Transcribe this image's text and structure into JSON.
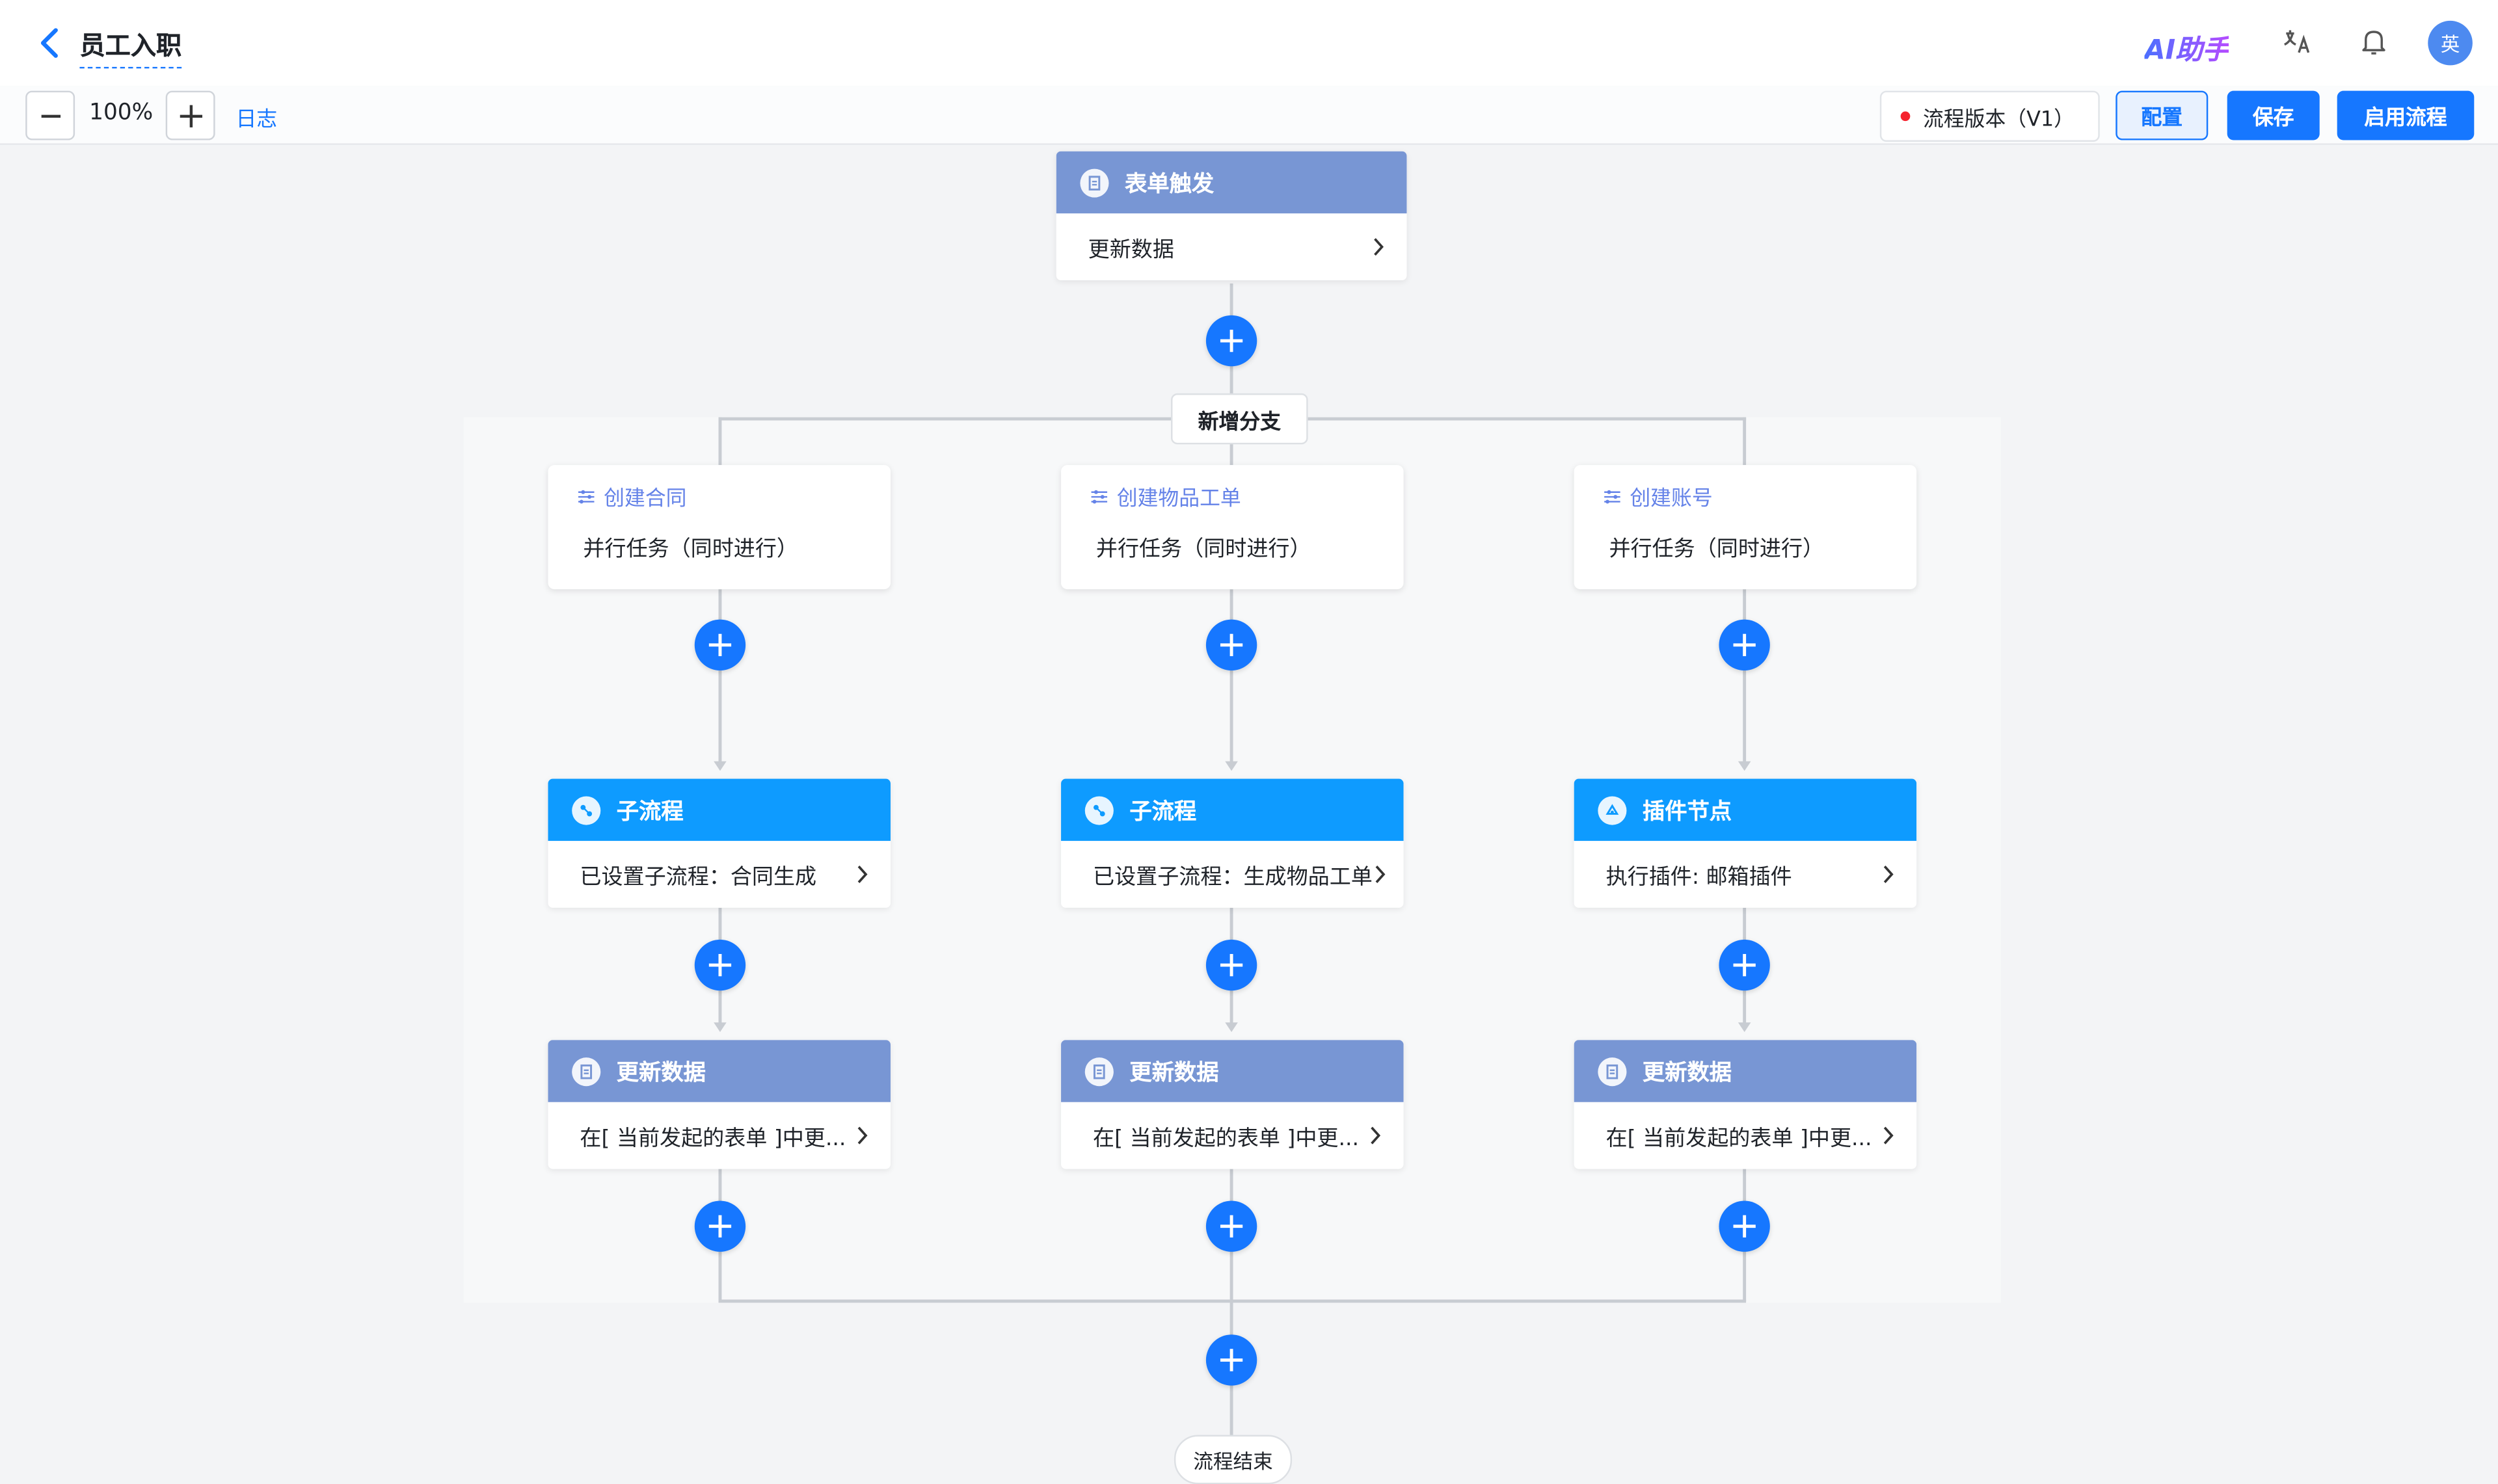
{
  "header": {
    "title": "员工入职",
    "ai_label": "AI助手",
    "avatar_text": "英"
  },
  "toolbar": {
    "zoom": "100%",
    "log_label": "日志",
    "version_label": "流程版本（V1）",
    "config_label": "配置",
    "save_label": "保存",
    "start_label": "启用流程"
  },
  "flow": {
    "trigger": {
      "title": "表单触发",
      "body": "更新数据"
    },
    "add_branch_label": "新增分支",
    "end_label": "流程结束",
    "branches": [
      {
        "parallel_title": "创建合同",
        "parallel_text": "并行任务（同时进行）",
        "node1_title": "子流程",
        "node1_body": "已设置子流程：合同生成",
        "node2_title": "更新数据",
        "node2_body": "在[ 当前发起的表单 ]中更..."
      },
      {
        "parallel_title": "创建物品工单",
        "parallel_text": "并行任务（同时进行）",
        "node1_title": "子流程",
        "node1_body": "已设置子流程：生成物品工单",
        "node2_title": "更新数据",
        "node2_body": "在[ 当前发起的表单 ]中更..."
      },
      {
        "parallel_title": "创建账号",
        "parallel_text": "并行任务（同时进行）",
        "node1_title": "插件节点",
        "node1_body": "执行插件: 邮箱插件",
        "node2_title": "更新数据",
        "node2_body": "在[ 当前发起的表单 ]中更..."
      }
    ]
  },
  "colors": {
    "primary": "#1677ff",
    "data_node_header": "#7896d4",
    "subflow_header": "#0e9bff",
    "parallel_title": "#6583e8"
  }
}
